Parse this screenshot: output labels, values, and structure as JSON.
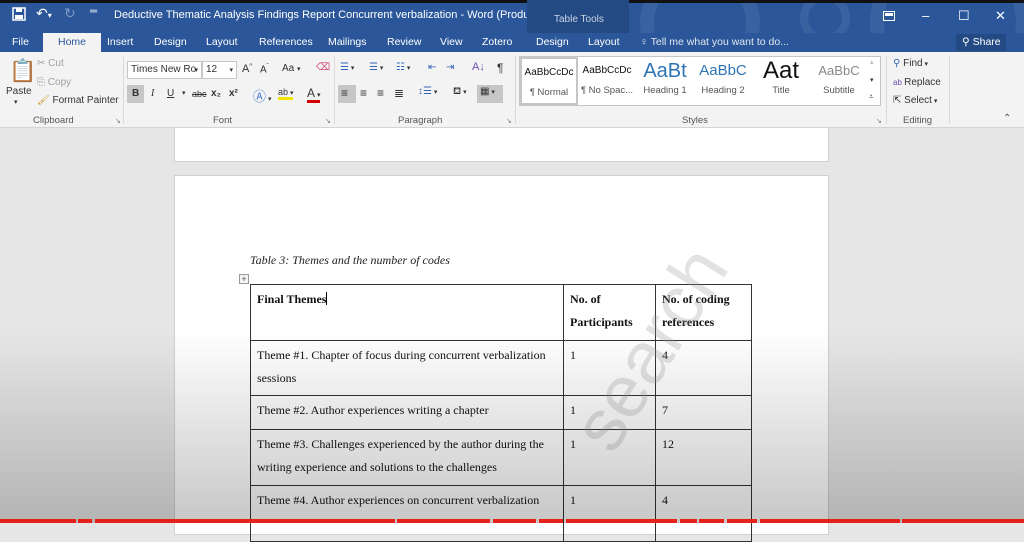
{
  "window": {
    "title": "Deductive Thematic Analysis Findings Report Concurrent verbalization - Word (Product Activ...",
    "context_tab_group": "Table Tools",
    "quick_access": {
      "save_icon": "save-icon",
      "undo_icon": "undo-icon",
      "redo_icon": "redo-icon",
      "customize_icon": "customize-qat-icon"
    },
    "controls": {
      "ribbon_display": "ribbon-display-options-icon",
      "minimize": "–",
      "maximize": "☐",
      "close": "✕"
    }
  },
  "tabs": [
    {
      "label": "File"
    },
    {
      "label": "Home",
      "active": true
    },
    {
      "label": "Insert"
    },
    {
      "label": "Design"
    },
    {
      "label": "Layout"
    },
    {
      "label": "References"
    },
    {
      "label": "Mailings"
    },
    {
      "label": "Review"
    },
    {
      "label": "View"
    },
    {
      "label": "Zotero"
    },
    {
      "label": "Design"
    },
    {
      "label": "Layout"
    }
  ],
  "tell_me": "Tell me what you want to do...",
  "share_label": "Share",
  "ribbon": {
    "clipboard": {
      "label": "Clipboard",
      "paste": "Paste",
      "cut": "Cut",
      "copy": "Copy",
      "format_painter": "Format Painter"
    },
    "font": {
      "label": "Font",
      "font_name": "Times New Ro",
      "font_size": "12",
      "grow": "A",
      "shrink": "A",
      "change_case": "Aa",
      "bold": "B",
      "italic": "I",
      "underline": "U",
      "strike": "abc",
      "subscript": "x₂",
      "superscript": "x²",
      "highlight_color": "#f2e600",
      "font_color": "#d00000"
    },
    "paragraph": {
      "label": "Paragraph",
      "pilcrow": "¶"
    },
    "styles": {
      "label": "Styles",
      "items": [
        {
          "preview": "AaBbCcDc",
          "name": "¶ Normal",
          "selected": true
        },
        {
          "preview": "AaBbCcDc",
          "name": "¶ No Spac..."
        },
        {
          "preview": "AaBt",
          "name": "Heading 1"
        },
        {
          "preview": "AaBbC",
          "name": "Heading 2"
        },
        {
          "preview": "Aat",
          "name": "Title"
        },
        {
          "preview": "AaBbC",
          "name": "Subtitle"
        }
      ]
    },
    "editing": {
      "label": "Editing",
      "find": "Find",
      "replace": "Replace",
      "select": "Select"
    }
  },
  "document": {
    "caption": "Table 3: Themes and the number of codes",
    "table": {
      "headers": [
        "Final Themes",
        "No. of Participants",
        "No. of coding references"
      ],
      "rows": [
        {
          "theme": "Theme #1. Chapter of focus during concurrent verbalization sessions",
          "participants": "1",
          "references": "4"
        },
        {
          "theme": "Theme #2. Author experiences writing a chapter",
          "participants": "1",
          "references": "7"
        },
        {
          "theme": "Theme #3. Challenges experienced by the author during the writing experience and solutions to the challenges",
          "participants": "1",
          "references": "12"
        },
        {
          "theme": "Theme #4. Author experiences on concurrent verbalization",
          "participants": "1",
          "references": "4"
        }
      ]
    },
    "watermark": "search"
  },
  "video_progress": {
    "played_fraction": 1.0,
    "color": "#e62117"
  }
}
